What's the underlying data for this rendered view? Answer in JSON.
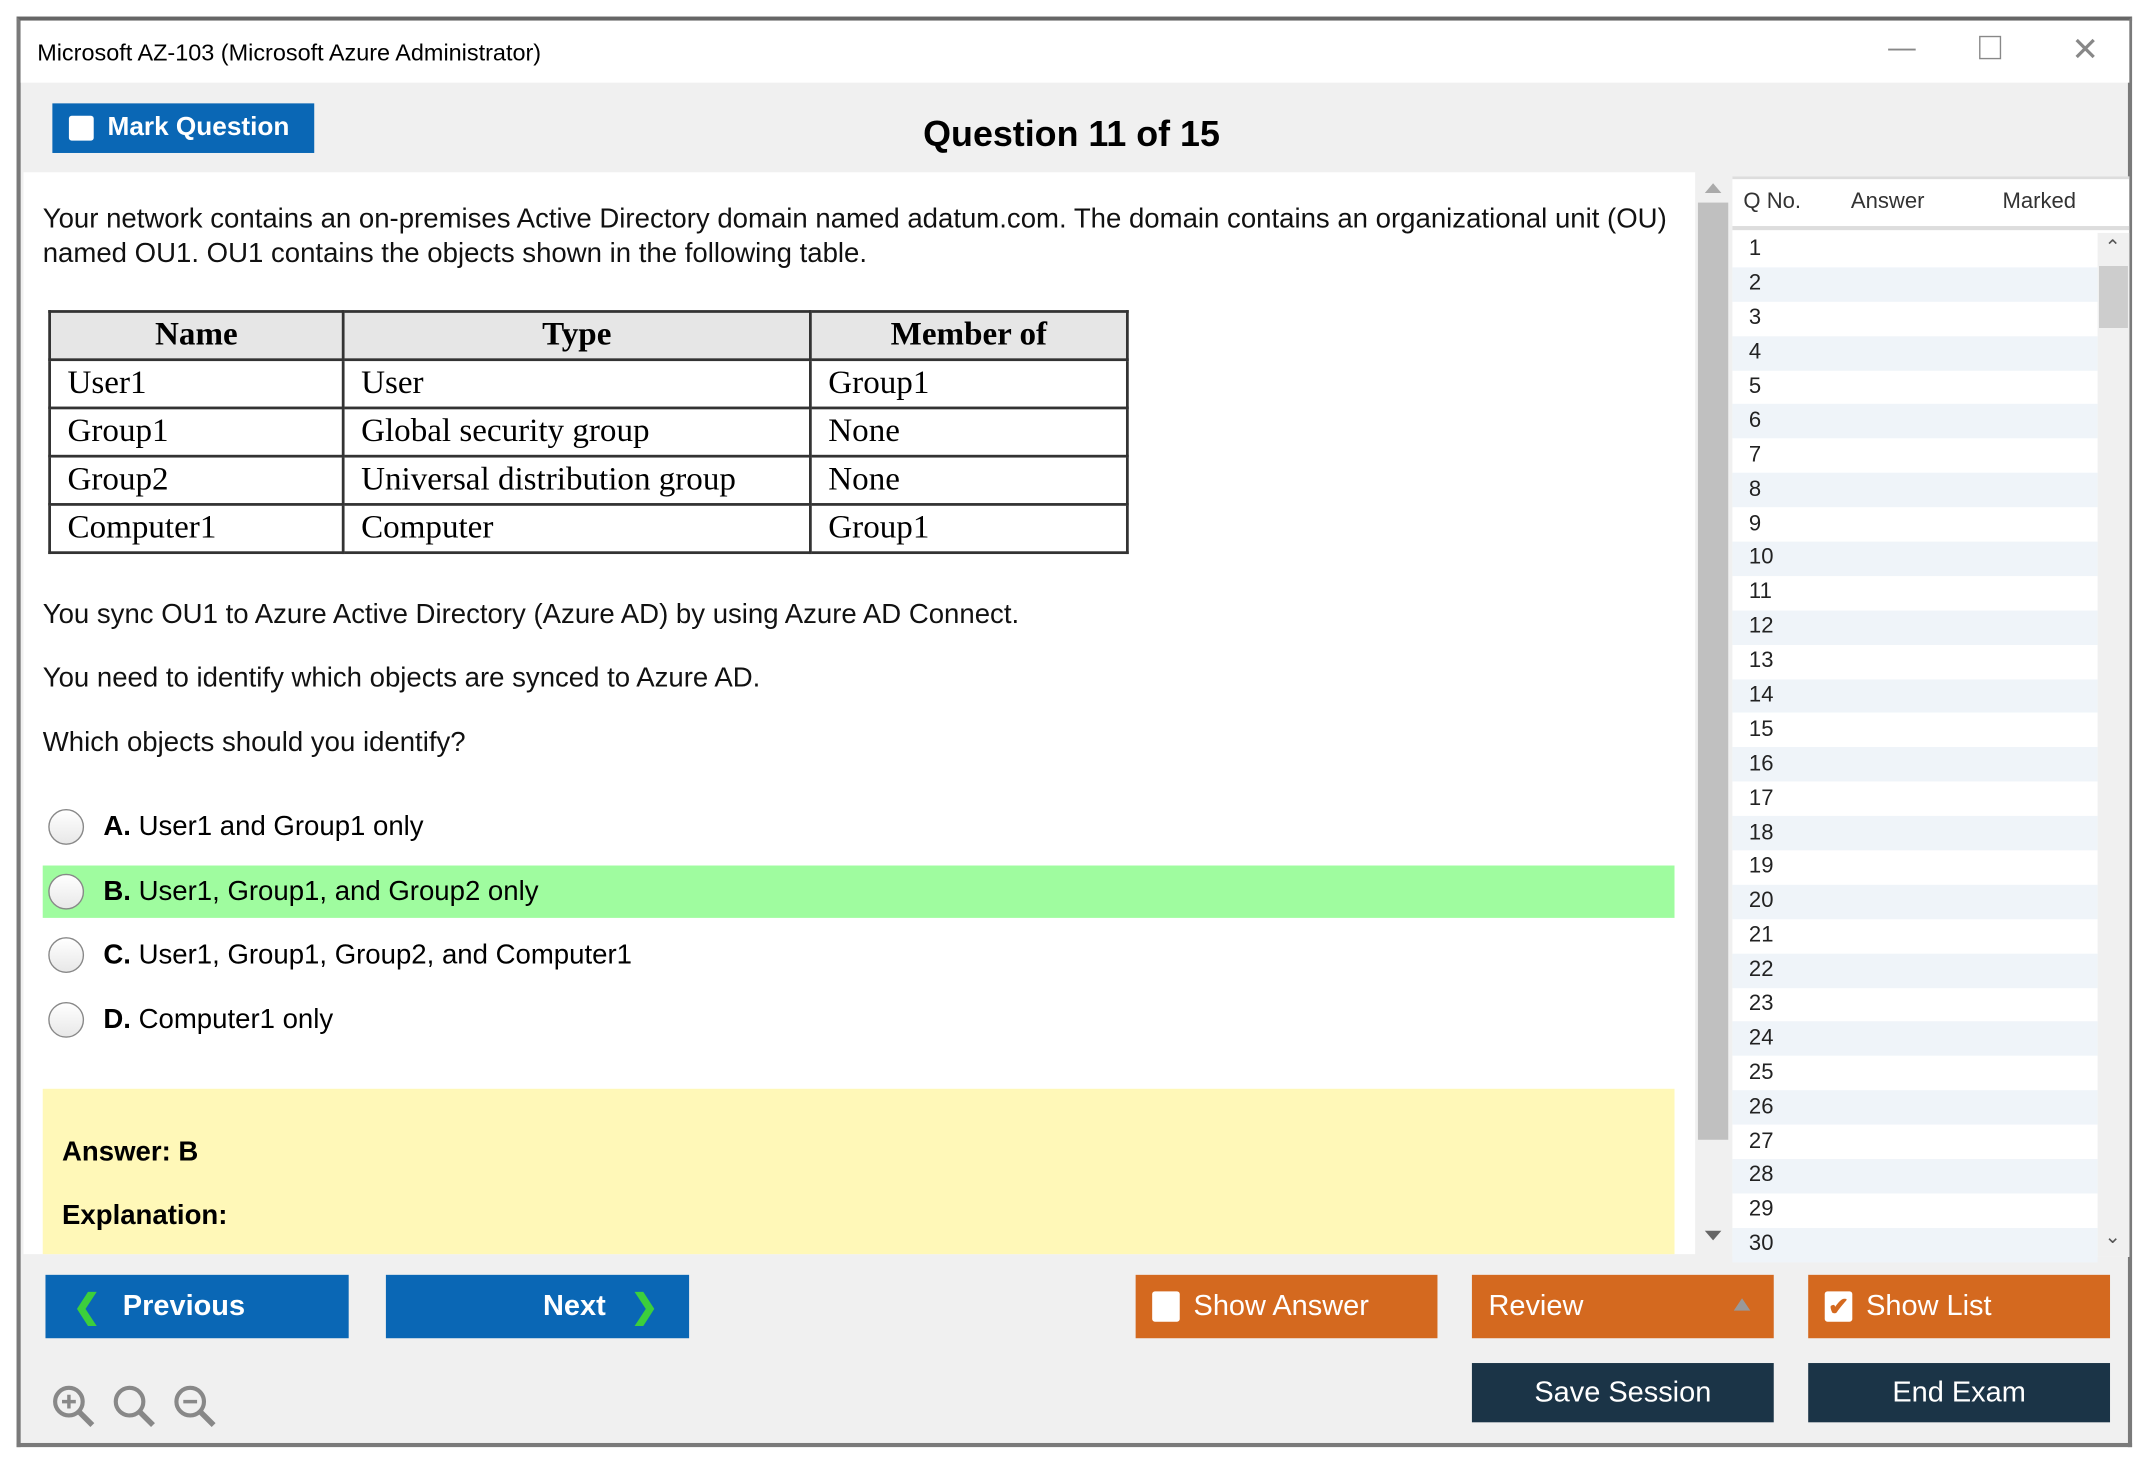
{
  "window": {
    "title": "Microsoft AZ-103 (Microsoft Azure Administrator)",
    "controls": [
      "minimize",
      "maximize",
      "close"
    ]
  },
  "header": {
    "mark_question": "Mark Question",
    "question_title": "Question 11 of 15"
  },
  "question": {
    "intro": "Your network contains an on-premises Active Directory domain named adatum.com. The domain contains an organizational unit (OU) named OU1. OU1 contains the objects shown in the following table.",
    "table": {
      "headers": [
        "Name",
        "Type",
        "Member of"
      ],
      "rows": [
        [
          "User1",
          "User",
          "Group1"
        ],
        [
          "Group1",
          "Global security group",
          "None"
        ],
        [
          "Group2",
          "Universal distribution group",
          "None"
        ],
        [
          "Computer1",
          "Computer",
          "Group1"
        ]
      ]
    },
    "p1": "You sync OU1 to Azure Active Directory (Azure AD) by using Azure AD Connect.",
    "p2": "You need to identify which objects are synced to Azure AD.",
    "p3": "Which objects should you identify?",
    "options": [
      {
        "letter": "A.",
        "text": "User1 and Group1 only"
      },
      {
        "letter": "B.",
        "text": "User1, Group1, and Group2 only",
        "highlighted": true
      },
      {
        "letter": "C.",
        "text": "User1, Group1, Group2, and Computer1"
      },
      {
        "letter": "D.",
        "text": "Computer1 only"
      }
    ],
    "answer": "Answer: B",
    "explanation": "Explanation:"
  },
  "list": {
    "headers": [
      "Q No.",
      "Answer",
      "Marked"
    ],
    "rows": [
      "1",
      "2",
      "3",
      "4",
      "5",
      "6",
      "7",
      "8",
      "9",
      "10",
      "11",
      "12",
      "13",
      "14",
      "15",
      "16",
      "17",
      "18",
      "19",
      "20",
      "21",
      "22",
      "23",
      "24",
      "25",
      "26",
      "27",
      "28",
      "29",
      "30"
    ]
  },
  "footer": {
    "previous": "Previous",
    "next": "Next",
    "show_answer": "Show Answer",
    "show_answer_checked": false,
    "review": "Review",
    "show_list": "Show List",
    "show_list_checked": true,
    "save_session": "Save Session",
    "end_exam": "End Exam",
    "zoom_icons": [
      "zoom-in-icon",
      "zoom-reset-icon",
      "zoom-out-icon"
    ]
  },
  "colors": {
    "blue": "#0a67b5",
    "orange": "#d4691f",
    "navy": "#1b3447",
    "highlight": "#9ffc9f",
    "answer_bg": "#fff8b8"
  }
}
